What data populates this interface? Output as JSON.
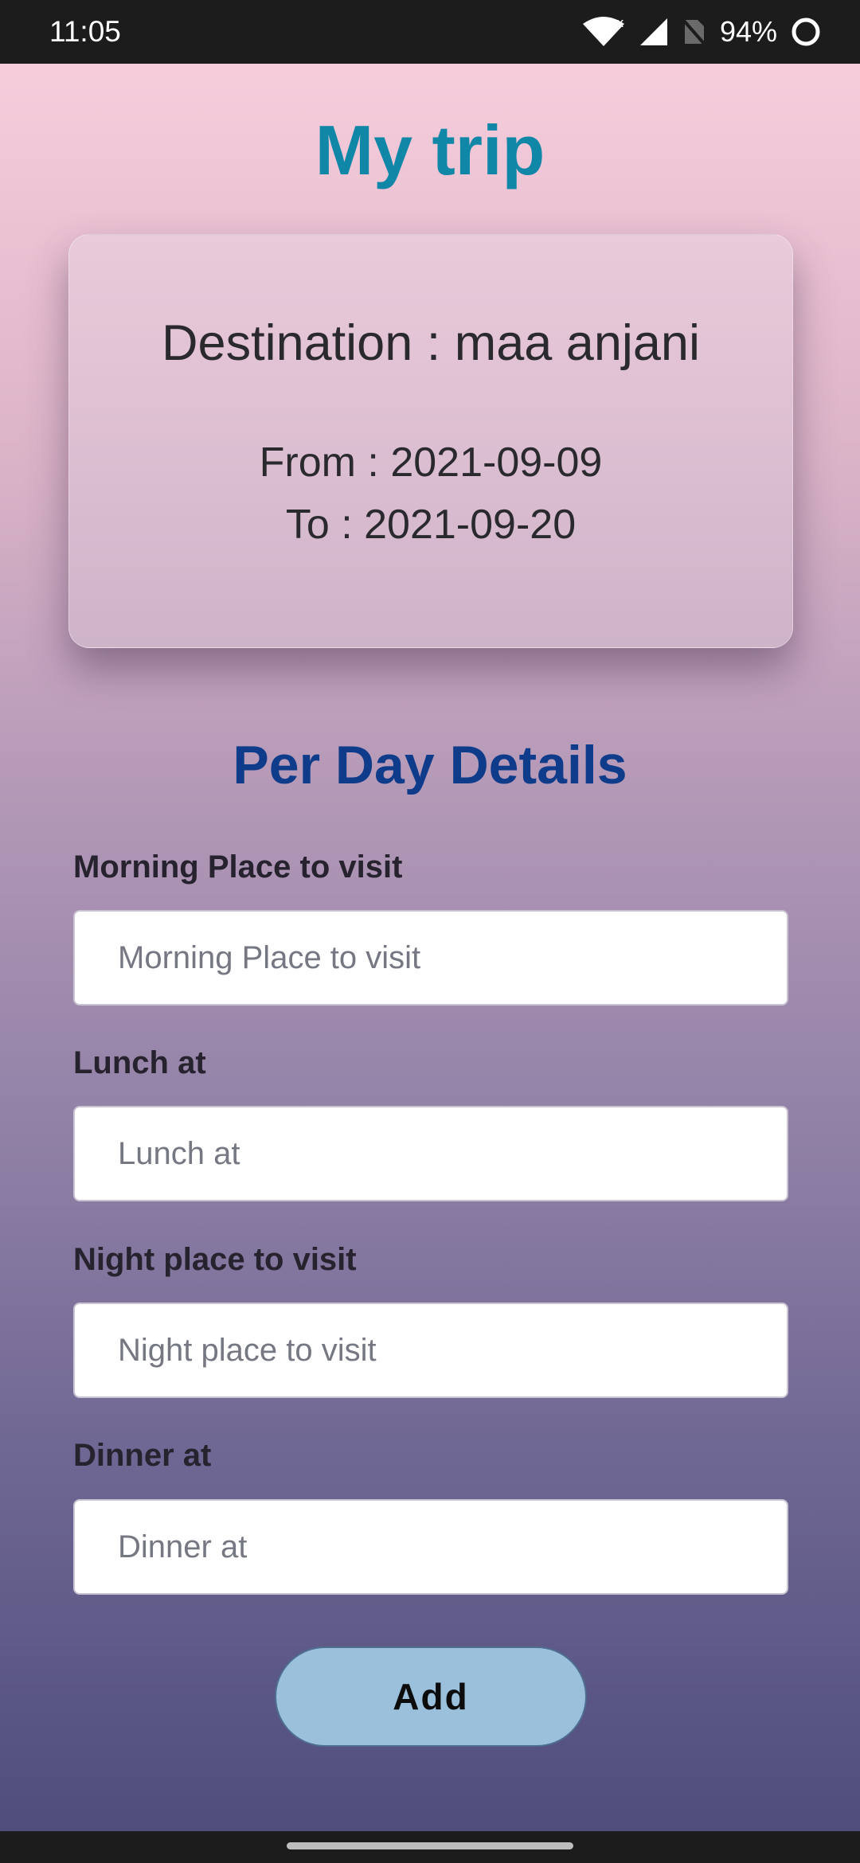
{
  "status_bar": {
    "time": "11:05",
    "battery": "94%",
    "icons": [
      "wifi-icon",
      "cell-signal-icon",
      "no-sim-icon",
      "battery-ring-icon"
    ]
  },
  "app": {
    "title": "My trip"
  },
  "trip": {
    "destination_text": "Destination : maa anjani",
    "from_text": "From : 2021-09-09",
    "to_text": "To : 2021-09-20"
  },
  "details": {
    "section_title": "Per Day Details",
    "fields": [
      {
        "label": "Morning Place to visit",
        "placeholder": "Morning Place to visit",
        "value": ""
      },
      {
        "label": "Lunch at",
        "placeholder": "Lunch at",
        "value": ""
      },
      {
        "label": "Night place to visit",
        "placeholder": "Night place to visit",
        "value": ""
      },
      {
        "label": "Dinner at",
        "placeholder": "Dinner at",
        "value": ""
      }
    ],
    "add_label": "Add"
  },
  "colors": {
    "title": "#1187a8",
    "section_title": "#0f3c8a",
    "button": "#9ac0dc",
    "gradient_top": "#f6cddb",
    "gradient_bottom": "#4f4d7c"
  }
}
